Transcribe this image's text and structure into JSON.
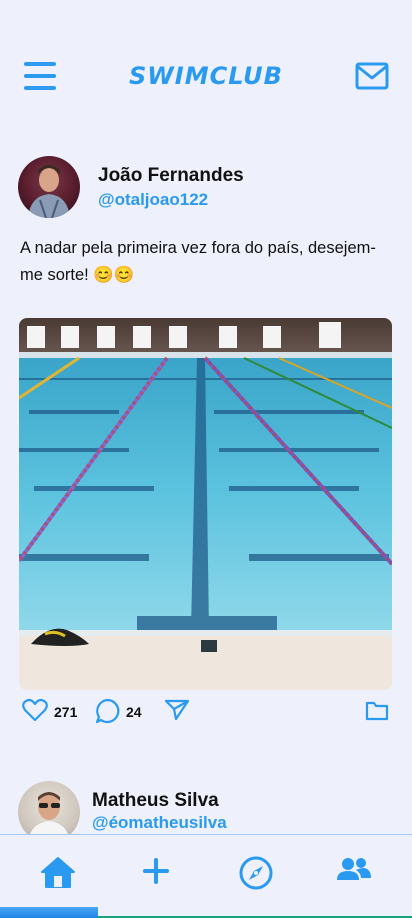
{
  "header": {
    "title": "SWIMCLUB",
    "menu_icon": "hamburger-menu-icon",
    "mail_icon": "mail-icon"
  },
  "posts": [
    {
      "author": "João Fernandes",
      "handle": "@otaljoao122",
      "text": "A nadar pela primeira vez fora do país, desejem-me sorte! 😊😊",
      "likes": "271",
      "comments": "24",
      "image": "swimming-pool-photo"
    },
    {
      "author": "Matheus Silva",
      "handle": "@éomatheusilva"
    }
  ],
  "bottom_nav": {
    "items": [
      "home-icon",
      "plus-icon",
      "compass-icon",
      "users-icon"
    ],
    "active": "home"
  },
  "colors": {
    "accent": "#2a9af0",
    "background": "#eef1fb"
  }
}
